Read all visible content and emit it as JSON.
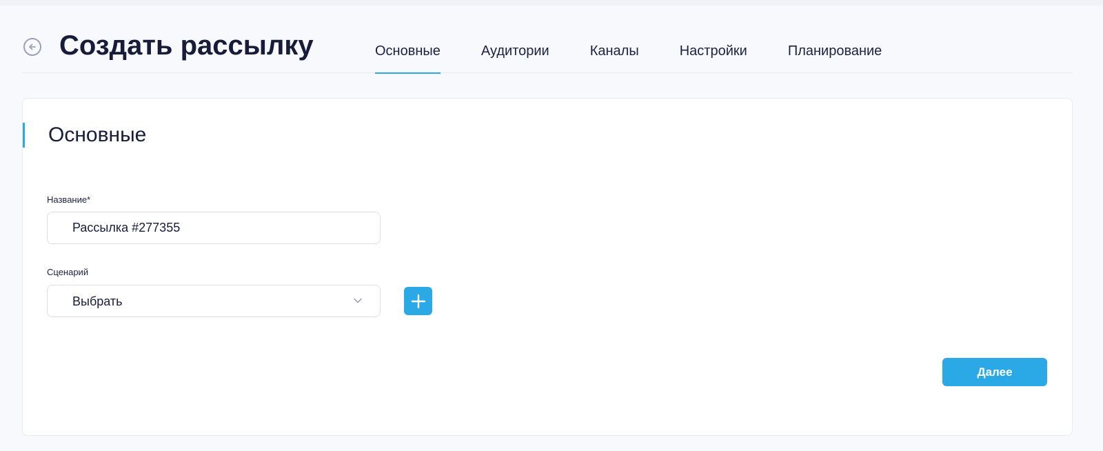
{
  "header": {
    "title": "Создать рассылку",
    "back_icon": "arrow-left-circle-icon",
    "tabs": [
      {
        "label": "Основные",
        "active": true
      },
      {
        "label": "Аудитории",
        "active": false
      },
      {
        "label": "Каналы",
        "active": false
      },
      {
        "label": "Настройки",
        "active": false
      },
      {
        "label": "Планирование",
        "active": false
      }
    ]
  },
  "section": {
    "title": "Основные"
  },
  "form": {
    "name": {
      "label": "Название*",
      "value": "Рассылка #277355"
    },
    "scenario": {
      "label": "Сценарий",
      "value": "Выбрать",
      "icon": "chevron-down-icon"
    },
    "add_icon": "plus-icon"
  },
  "actions": {
    "next_label": "Далее"
  },
  "colors": {
    "accent": "#2aa9e6",
    "text": "#161c3a",
    "background": "#f8f9fc"
  }
}
